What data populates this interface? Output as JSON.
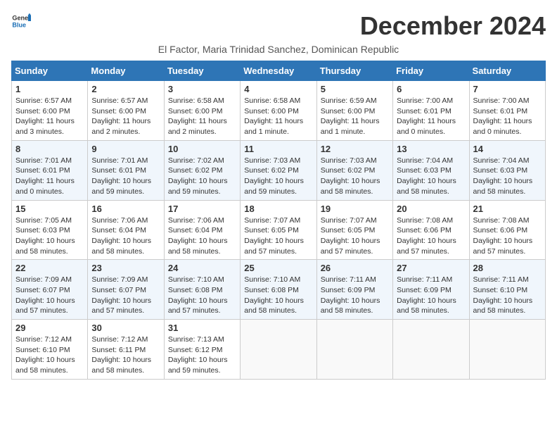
{
  "header": {
    "logo_general": "General",
    "logo_blue": "Blue",
    "month": "December 2024",
    "location": "El Factor, Maria Trinidad Sanchez, Dominican Republic"
  },
  "weekdays": [
    "Sunday",
    "Monday",
    "Tuesday",
    "Wednesday",
    "Thursday",
    "Friday",
    "Saturday"
  ],
  "weeks": [
    [
      {
        "day": "1",
        "info": "Sunrise: 6:57 AM\nSunset: 6:00 PM\nDaylight: 11 hours\nand 3 minutes."
      },
      {
        "day": "2",
        "info": "Sunrise: 6:57 AM\nSunset: 6:00 PM\nDaylight: 11 hours\nand 2 minutes."
      },
      {
        "day": "3",
        "info": "Sunrise: 6:58 AM\nSunset: 6:00 PM\nDaylight: 11 hours\nand 2 minutes."
      },
      {
        "day": "4",
        "info": "Sunrise: 6:58 AM\nSunset: 6:00 PM\nDaylight: 11 hours\nand 1 minute."
      },
      {
        "day": "5",
        "info": "Sunrise: 6:59 AM\nSunset: 6:00 PM\nDaylight: 11 hours\nand 1 minute."
      },
      {
        "day": "6",
        "info": "Sunrise: 7:00 AM\nSunset: 6:01 PM\nDaylight: 11 hours\nand 0 minutes."
      },
      {
        "day": "7",
        "info": "Sunrise: 7:00 AM\nSunset: 6:01 PM\nDaylight: 11 hours\nand 0 minutes."
      }
    ],
    [
      {
        "day": "8",
        "info": "Sunrise: 7:01 AM\nSunset: 6:01 PM\nDaylight: 11 hours\nand 0 minutes."
      },
      {
        "day": "9",
        "info": "Sunrise: 7:01 AM\nSunset: 6:01 PM\nDaylight: 10 hours\nand 59 minutes."
      },
      {
        "day": "10",
        "info": "Sunrise: 7:02 AM\nSunset: 6:02 PM\nDaylight: 10 hours\nand 59 minutes."
      },
      {
        "day": "11",
        "info": "Sunrise: 7:03 AM\nSunset: 6:02 PM\nDaylight: 10 hours\nand 59 minutes."
      },
      {
        "day": "12",
        "info": "Sunrise: 7:03 AM\nSunset: 6:02 PM\nDaylight: 10 hours\nand 58 minutes."
      },
      {
        "day": "13",
        "info": "Sunrise: 7:04 AM\nSunset: 6:03 PM\nDaylight: 10 hours\nand 58 minutes."
      },
      {
        "day": "14",
        "info": "Sunrise: 7:04 AM\nSunset: 6:03 PM\nDaylight: 10 hours\nand 58 minutes."
      }
    ],
    [
      {
        "day": "15",
        "info": "Sunrise: 7:05 AM\nSunset: 6:03 PM\nDaylight: 10 hours\nand 58 minutes."
      },
      {
        "day": "16",
        "info": "Sunrise: 7:06 AM\nSunset: 6:04 PM\nDaylight: 10 hours\nand 58 minutes."
      },
      {
        "day": "17",
        "info": "Sunrise: 7:06 AM\nSunset: 6:04 PM\nDaylight: 10 hours\nand 58 minutes."
      },
      {
        "day": "18",
        "info": "Sunrise: 7:07 AM\nSunset: 6:05 PM\nDaylight: 10 hours\nand 57 minutes."
      },
      {
        "day": "19",
        "info": "Sunrise: 7:07 AM\nSunset: 6:05 PM\nDaylight: 10 hours\nand 57 minutes."
      },
      {
        "day": "20",
        "info": "Sunrise: 7:08 AM\nSunset: 6:06 PM\nDaylight: 10 hours\nand 57 minutes."
      },
      {
        "day": "21",
        "info": "Sunrise: 7:08 AM\nSunset: 6:06 PM\nDaylight: 10 hours\nand 57 minutes."
      }
    ],
    [
      {
        "day": "22",
        "info": "Sunrise: 7:09 AM\nSunset: 6:07 PM\nDaylight: 10 hours\nand 57 minutes."
      },
      {
        "day": "23",
        "info": "Sunrise: 7:09 AM\nSunset: 6:07 PM\nDaylight: 10 hours\nand 57 minutes."
      },
      {
        "day": "24",
        "info": "Sunrise: 7:10 AM\nSunset: 6:08 PM\nDaylight: 10 hours\nand 57 minutes."
      },
      {
        "day": "25",
        "info": "Sunrise: 7:10 AM\nSunset: 6:08 PM\nDaylight: 10 hours\nand 58 minutes."
      },
      {
        "day": "26",
        "info": "Sunrise: 7:11 AM\nSunset: 6:09 PM\nDaylight: 10 hours\nand 58 minutes."
      },
      {
        "day": "27",
        "info": "Sunrise: 7:11 AM\nSunset: 6:09 PM\nDaylight: 10 hours\nand 58 minutes."
      },
      {
        "day": "28",
        "info": "Sunrise: 7:11 AM\nSunset: 6:10 PM\nDaylight: 10 hours\nand 58 minutes."
      }
    ],
    [
      {
        "day": "29",
        "info": "Sunrise: 7:12 AM\nSunset: 6:10 PM\nDaylight: 10 hours\nand 58 minutes."
      },
      {
        "day": "30",
        "info": "Sunrise: 7:12 AM\nSunset: 6:11 PM\nDaylight: 10 hours\nand 58 minutes."
      },
      {
        "day": "31",
        "info": "Sunrise: 7:13 AM\nSunset: 6:12 PM\nDaylight: 10 hours\nand 59 minutes."
      },
      {
        "day": "",
        "info": ""
      },
      {
        "day": "",
        "info": ""
      },
      {
        "day": "",
        "info": ""
      },
      {
        "day": "",
        "info": ""
      }
    ]
  ]
}
